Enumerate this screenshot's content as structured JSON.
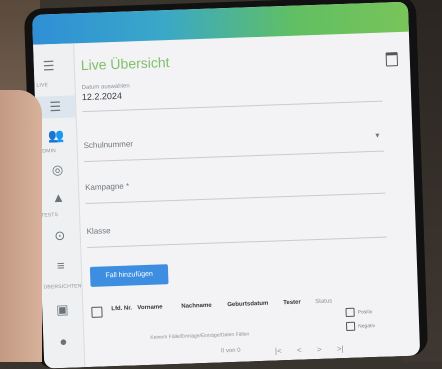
{
  "app": {
    "title": "Live Übersicht"
  },
  "sidebar": {
    "items": [
      {
        "label": "LIVE",
        "icon": "list-icon"
      },
      {
        "label": "",
        "icon": "users-icon"
      },
      {
        "label": "ADMIN",
        "icon": "globe-icon"
      },
      {
        "label": "",
        "icon": "graduation-cap-icon"
      },
      {
        "label": "TESTS",
        "icon": "check-circle-icon"
      },
      {
        "label": "",
        "icon": "sliders-icon"
      },
      {
        "label": "ÜBERSICHTEN",
        "icon": "calendar-icon"
      },
      {
        "label": "",
        "icon": "location-pin-icon"
      }
    ]
  },
  "form": {
    "date": {
      "label": "Datum auswählen",
      "value": "12.2.2024"
    },
    "schulnummer": {
      "placeholder": "Schulnummer"
    },
    "kampagne": {
      "placeholder": "Kampagne *"
    },
    "klasse": {
      "placeholder": "Klasse"
    }
  },
  "actions": {
    "add_case": "Fall hinzufügen"
  },
  "table": {
    "headers": [
      "Lfd. Nr.",
      "Vorname",
      "Nachname",
      "Geburtsdatum",
      "Tester",
      "Status"
    ],
    "empty_message": "Keine/n Fälle/Einträge/Einträge/Daten Fällen",
    "legend": [
      "Positiv",
      "Negativ"
    ],
    "pagination": "0 von 0"
  },
  "colors": {
    "accent": "#3d8ee0",
    "title": "#7fbf6a"
  }
}
